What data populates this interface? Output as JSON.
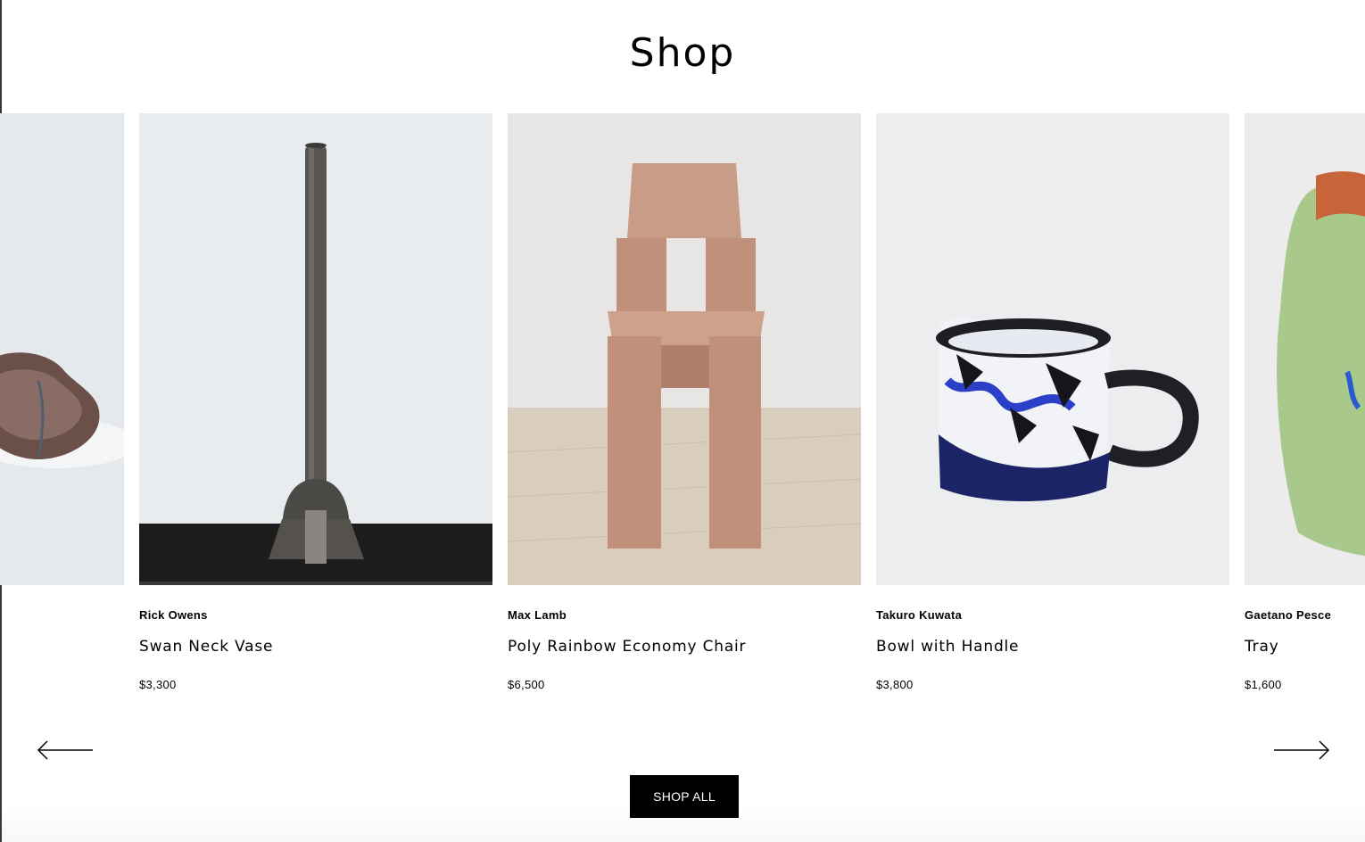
{
  "header": {
    "title": "Shop"
  },
  "products": [
    {
      "artist": "",
      "name": "",
      "price": ""
    },
    {
      "artist": "Rick Owens",
      "name": "Swan Neck Vase",
      "price": "$3,300"
    },
    {
      "artist": "Max Lamb",
      "name": "Poly Rainbow Economy Chair",
      "price": "$6,500"
    },
    {
      "artist": "Takuro Kuwata",
      "name": "Bowl with Handle",
      "price": "$3,800"
    },
    {
      "artist": "Gaetano Pesce",
      "name": "Tray",
      "price": "$1,600"
    }
  ],
  "carousel": {
    "prev_icon": "arrow-left-icon",
    "next_icon": "arrow-right-icon"
  },
  "cta": {
    "shop_all_label": "SHOP ALL"
  },
  "colors": {
    "background": "#ffffff",
    "button_bg": "#000000",
    "button_text": "#ffffff",
    "image_bg": "#e9ebee"
  }
}
